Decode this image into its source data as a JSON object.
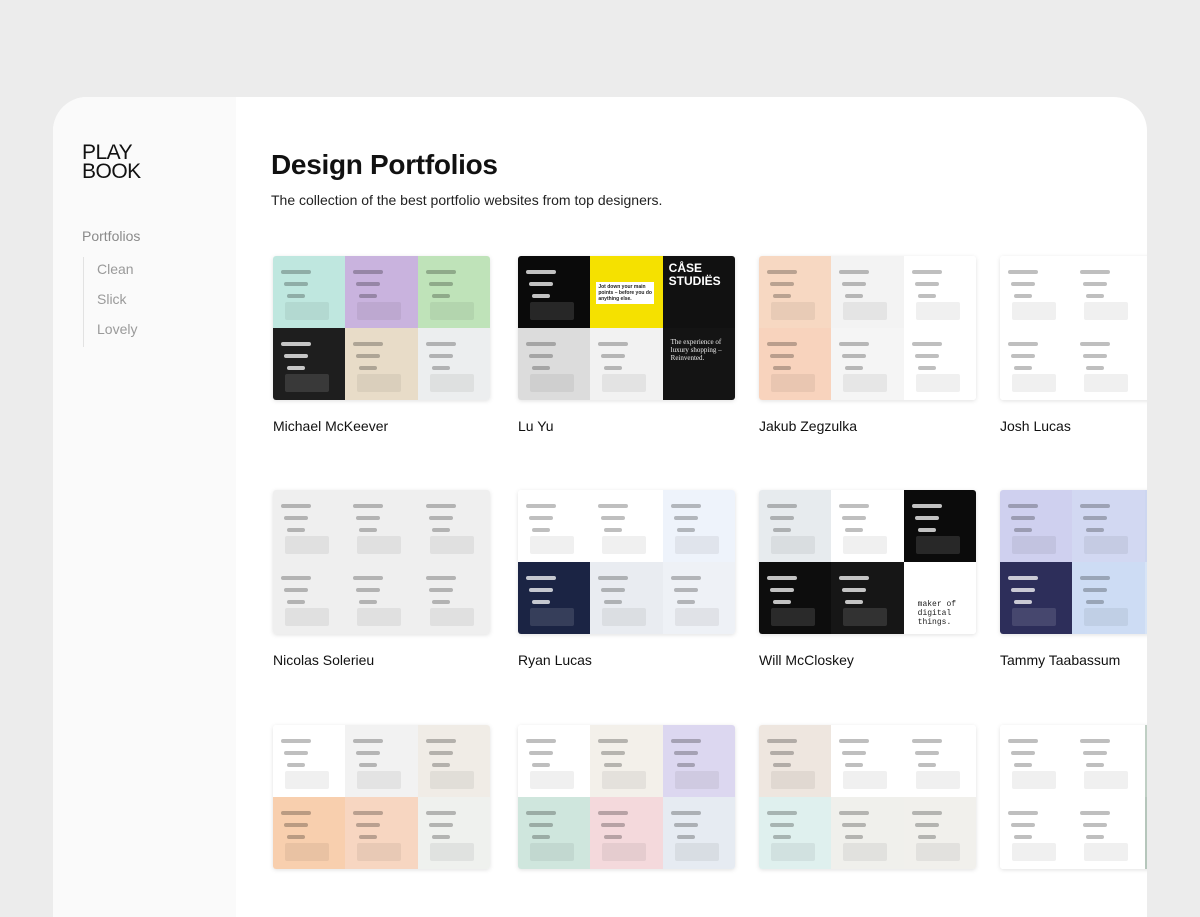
{
  "sidebar": {
    "logo": [
      "PLAY",
      "BOOK"
    ],
    "section": "Portfolios",
    "items": [
      "Clean",
      "Slick",
      "Lovely"
    ]
  },
  "main": {
    "title": "Design Portfolios",
    "subtitle": "The collection of the best portfolio websites from top designers."
  },
  "cards": [
    {
      "name": "Michael McKeever",
      "colors": [
        "#bfe7df",
        "#c9b3de",
        "#bfe3b9",
        "#1e1e1e",
        "#e8dcc8",
        "#eceeef"
      ]
    },
    {
      "name": "Lu Yu",
      "colors": [
        "#0a0a0a",
        "#f5e100",
        "#111111",
        "#dcdcdc",
        "#f2f2f2",
        "#141414"
      ]
    },
    {
      "name": "Jakub Zegzulka",
      "colors": [
        "#f7d8c2",
        "#f3f3f3",
        "#ffffff",
        "#f8d3bd",
        "#f5f5f5",
        "#ffffff"
      ]
    },
    {
      "name": "Josh Lucas",
      "colors": [
        "#ffffff",
        "#ffffff",
        "#ffffff",
        "#ffffff",
        "#ffffff",
        "#ffffff"
      ]
    },
    {
      "name": "Nicolas Solerieu",
      "colors": [
        "#efefef",
        "#efefef",
        "#efefef",
        "#efefef",
        "#efefef",
        "#efefef"
      ]
    },
    {
      "name": "Ryan Lucas",
      "colors": [
        "#ffffff",
        "#ffffff",
        "#eef3fb",
        "#1b2444",
        "#e9ecf1",
        "#eef1f6"
      ]
    },
    {
      "name": "Will McCloskey",
      "colors": [
        "#e7ebee",
        "#ffffff",
        "#0b0b0b",
        "#0d0d0d",
        "#161616",
        "#ffffff"
      ]
    },
    {
      "name": "Tammy Taabassum",
      "colors": [
        "#cfd0ef",
        "#d2d8f2",
        "#cdd6f0",
        "#2d2e5a",
        "#cddcf4",
        "#d7e4f6"
      ]
    },
    {
      "name": "",
      "colors": [
        "#ffffff",
        "#f2f2f2",
        "#f0ece6",
        "#f8cfae",
        "#f7d6c1",
        "#eff1ee"
      ]
    },
    {
      "name": "",
      "colors": [
        "#ffffff",
        "#f3f0ea",
        "#dcd7f0",
        "#cfe6dd",
        "#f4d9dc",
        "#e6ebf2"
      ]
    },
    {
      "name": "",
      "colors": [
        "#eee6df",
        "#ffffff",
        "#ffffff",
        "#dff0ee",
        "#f0f0ec",
        "#f1f0ec"
      ]
    },
    {
      "name": "",
      "colors": [
        "#ffffff",
        "#ffffff",
        "#bfcfc4",
        "#ffffff",
        "#ffffff",
        "#b5c6bb"
      ]
    }
  ],
  "thumb_text": {
    "luyu_case": "CÅSE STUDIËS",
    "luyu_exp": "The experience of luxury shopping – Reinvented.",
    "luyu_main": "Jot down your main points – before you do anything else.",
    "will_maker": "maker of digital things."
  }
}
